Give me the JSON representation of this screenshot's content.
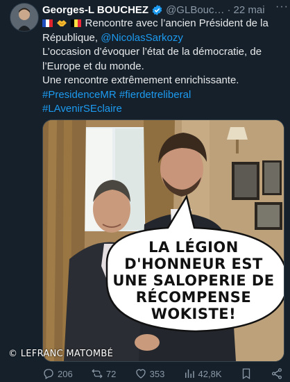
{
  "author": {
    "name": "Georges-L BOUCHEZ",
    "handle": "@GLBouc…",
    "separator": "·",
    "date": "22 mai",
    "more": "···"
  },
  "tweet": {
    "line1": "Rencontre avec l’ancien Président de la",
    "line2_text": "République, ",
    "mention": "@NicolasSarkozy",
    "line3": "L’occasion d’évoquer l’état de la démocratie, de",
    "line4": "l’Europe et du monde.",
    "line5": "Une rencontre extrêmement enrichissante.",
    "hashtag1": "#PresidenceMR",
    "hashtag2": "#fierdetreliberal",
    "hashtag3": "#LAvenirSEclaire"
  },
  "speech_bubble": {
    "line1": "LA LÉGION",
    "line2": "D'HONNEUR EST",
    "line3": "UNE SALOPERIE DE",
    "line4": "RÉCOMPENSE",
    "line5": "WOKISTE!"
  },
  "credit": "© LEFRANC MATOMBÉ",
  "actions": {
    "replies": "206",
    "reposts": "72",
    "likes": "353",
    "views": "42,8K"
  },
  "colors": {
    "background": "#15202b",
    "link": "#1d9bf0",
    "muted": "#8b98a5",
    "verified": "#1d9bf0"
  }
}
